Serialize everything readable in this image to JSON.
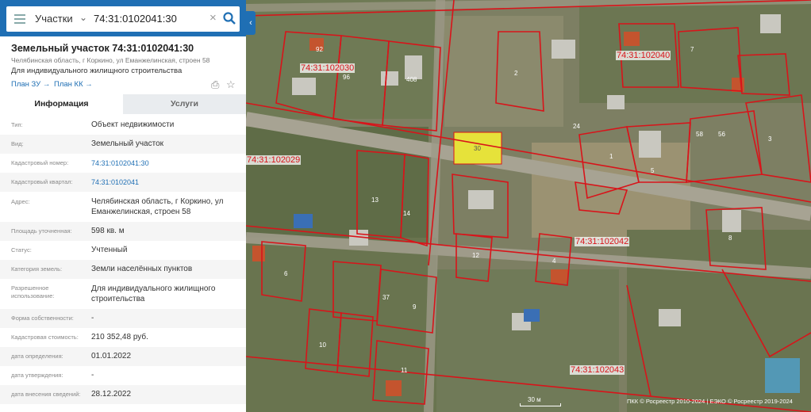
{
  "search": {
    "type_label": "Участки",
    "query": "74:31:0102041:30"
  },
  "object": {
    "title": "Земельный участок 74:31:0102041:30",
    "address_short": "Челябинская область, г Коркино, ул Еманжелинская, строен 58",
    "usage_short": "Для индивидуального жилищного строительства",
    "link_plan_zu": "План ЗУ →",
    "link_plan_kk": "План КК →"
  },
  "tabs": {
    "info": "Информация",
    "services": "Услуги"
  },
  "fields": [
    {
      "label": "Тип:",
      "value": "Объект недвижимости"
    },
    {
      "label": "Вид:",
      "value": "Земельный участок"
    },
    {
      "label": "Кадастровый номер:",
      "value": "74:31:0102041:30"
    },
    {
      "label": "Кадастровый квартал:",
      "value": "74:31:0102041"
    },
    {
      "label": "Адрес:",
      "value": "Челябинская область, г Коркино, ул Еманжелинская, строен 58"
    },
    {
      "label": "Площадь уточненная:",
      "value": "598 кв. м"
    },
    {
      "label": "Статус:",
      "value": "Учтенный"
    },
    {
      "label": "Категория земель:",
      "value": "Земли населённых пунктов"
    },
    {
      "label": "Разрешенное использование:",
      "value": "Для индивидуального жилищного строительства"
    },
    {
      "label": "Форма собственности:",
      "value": "-"
    },
    {
      "label": "Кадастровая стоимость:",
      "value": "210 352,48 руб."
    },
    {
      "label": "дата определения:",
      "value": "01.01.2022"
    },
    {
      "label": "дата утверждения:",
      "value": "-"
    },
    {
      "label": "дата внесения сведений:",
      "value": "28.12.2022"
    }
  ],
  "map": {
    "quarters": [
      "74:31:102030",
      "74:31:102040",
      "74:31:102029",
      "74:31:102042",
      "74:31:102043"
    ],
    "plot_numbers": [
      "30",
      "2",
      "1",
      "12",
      "13",
      "14",
      "6",
      "8",
      "9",
      "37",
      "11",
      "4",
      "3",
      "7",
      "5",
      "10",
      "24",
      "58",
      "92",
      "96",
      "408",
      "56"
    ],
    "scale": "30 м",
    "copyright": "ПКК © Росреестр 2010-2024 | ЕЭКО © Росреестр 2019-2024",
    "highlight_color": "#e6e23a",
    "boundary_color": "#d8141a"
  }
}
